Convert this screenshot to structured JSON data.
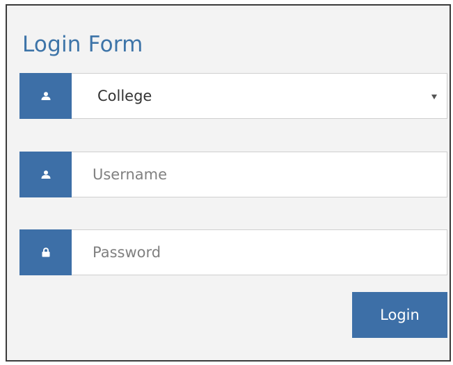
{
  "form": {
    "title": "Login Form",
    "college_select": {
      "selected": "College",
      "icon": "user-icon"
    },
    "username": {
      "placeholder": "Username",
      "value": "",
      "icon": "user-icon"
    },
    "password": {
      "placeholder": "Password",
      "value": "",
      "icon": "lock-icon"
    },
    "login_label": "Login"
  },
  "colors": {
    "accent": "#3d6fa7",
    "title": "#3d74a8",
    "background": "#f3f3f3",
    "border": "#3a3a3a"
  }
}
